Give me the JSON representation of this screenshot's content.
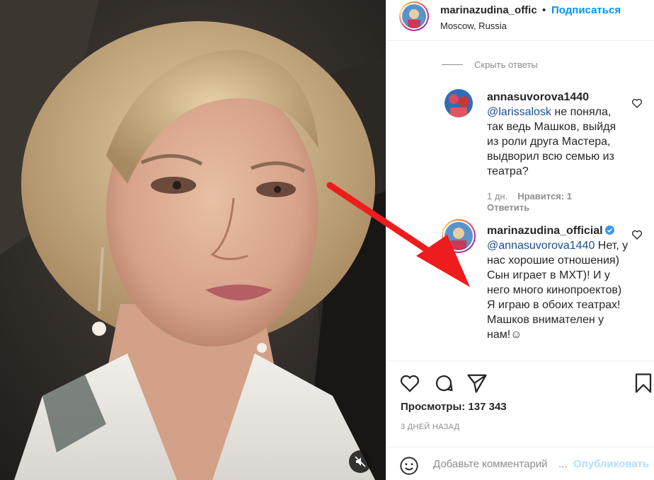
{
  "post": {
    "author": "marinazudina_offic",
    "dot": "•",
    "follow_label": "Подписаться",
    "location": "Moscow, Russia"
  },
  "comments_area": {
    "hide_replies_label": "Скрыть ответы"
  },
  "comments": [
    {
      "username": "annasuvorova1440",
      "mention": "@larissalosk",
      "text": " не поняла, так ведь Машков, выйдя из роли друга Мастера, выдворил всю семью из театра?",
      "age": "1 дн.",
      "likes": "Нравится: 1",
      "reply_label": "Ответить"
    },
    {
      "username": "marinazudina_official",
      "mention": "@annasuvorova1440",
      "text": " Нет, у нас хорошие отношения) Сын играет в МХТ)! И у него много кинопроектов) Я играю в обоих театрах! Машков внимателен у нам!☺"
    }
  ],
  "stats": {
    "views": "Просмотры: 137 343",
    "time_ago": "3 ДНЕЙ НАЗАД"
  },
  "add_comment": {
    "placeholder": "Добавьте комментарий",
    "ellipsis": "...",
    "publish_label": "Опубликовать"
  },
  "icons": {
    "like": "heart-icon",
    "comment": "comment-icon",
    "share": "share-icon",
    "save": "bookmark-icon",
    "mute": "speaker-muted-icon",
    "emoji": "smiley-icon"
  },
  "colors": {
    "follow": "#0095f6",
    "arrow": "#ee1c1c",
    "verified": "#3897f0"
  }
}
